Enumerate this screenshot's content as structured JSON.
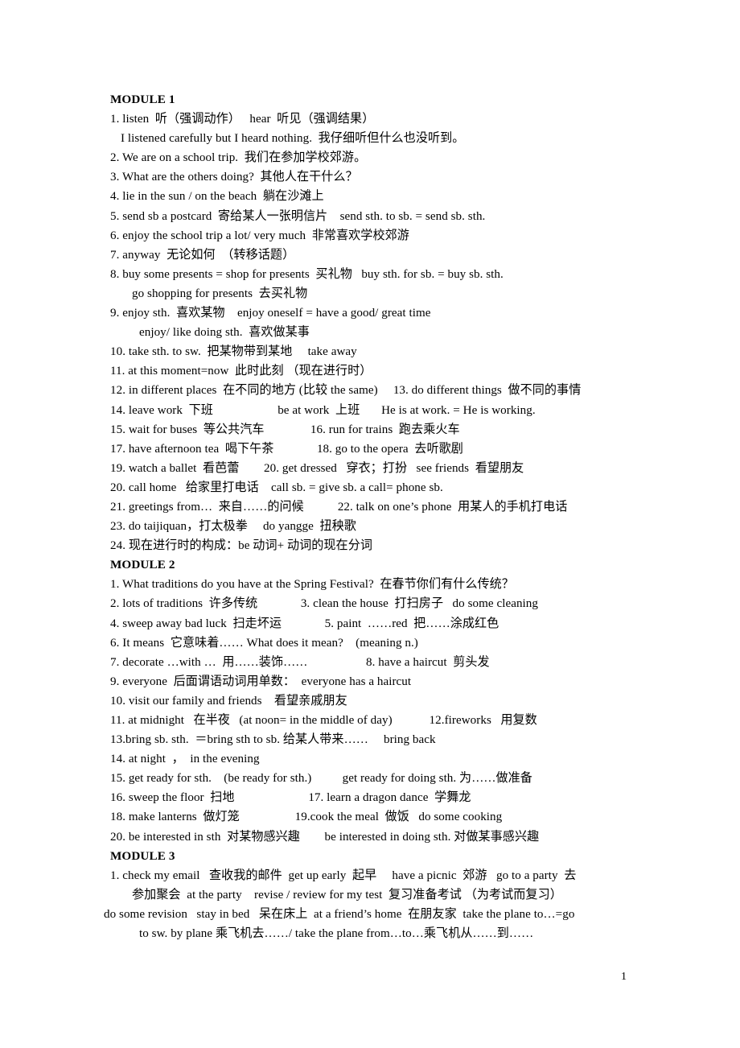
{
  "document": {
    "page_number": "1",
    "sections": [
      {
        "heading": "MODULE 1",
        "lines": [
          {
            "indent": 0,
            "text": "1. listen  听（强调动作）   hear  听见（强调结果）"
          },
          {
            "indent": 1,
            "text": "I listened carefully but I heard nothing.  我仔细听但什么也没听到。"
          },
          {
            "indent": 0,
            "text": "2. We are on a school trip.  我们在参加学校郊游。"
          },
          {
            "indent": 0,
            "text": "3. What are the others doing?  其他人在干什么？"
          },
          {
            "indent": 0,
            "text": "4. lie in the sun / on the beach  躺在沙滩上"
          },
          {
            "indent": 0,
            "text": "5. send sb a postcard  寄给某人一张明信片    send sth. to sb. = send sb. sth."
          },
          {
            "indent": 0,
            "text": "6. enjoy the school trip a lot/ very much  非常喜欢学校郊游"
          },
          {
            "indent": 0,
            "text": "7. anyway  无论如何  （转移话题）"
          },
          {
            "indent": 0,
            "text": "8. buy some presents = shop for presents  买礼物   buy sth. for sb. = buy sb. sth."
          },
          {
            "indent": 2,
            "text": "go shopping for presents  去买礼物"
          },
          {
            "indent": 0,
            "text": "9. enjoy sth.  喜欢某物    enjoy oneself = have a good/ great time"
          },
          {
            "indent": 3,
            "text": "enjoy/ like doing sth.  喜欢做某事"
          },
          {
            "indent": 0,
            "text": "10. take sth. to sw.  把某物带到某地     take away"
          },
          {
            "indent": 0,
            "text": "11. at this moment=now  此时此刻 （现在进行时）"
          },
          {
            "indent": 0,
            "text": "12. in different places  在不同的地方 (比较 the same)     13. do different things  做不同的事情"
          },
          {
            "indent": 0,
            "text": "14. leave work  下班                     be at work  上班       He is at work. = He is working."
          },
          {
            "indent": 0,
            "text": "15. wait for buses  等公共汽车               16. run for trains  跑去乘火车"
          },
          {
            "indent": 0,
            "text": "17. have afternoon tea  喝下午茶              18. go to the opera  去听歌剧"
          },
          {
            "indent": 0,
            "text": "19. watch a ballet  看芭蕾        20. get dressed   穿衣；打扮   see friends  看望朋友"
          },
          {
            "indent": 0,
            "text": "20. call home   给家里打电话    call sb. = give sb. a call= phone sb."
          },
          {
            "indent": 0,
            "text": "21. greetings from…  来自……的问候           22. talk on one’s phone  用某人的手机打电话"
          },
          {
            "indent": 0,
            "text": "23. do taijiquan，打太极拳     do yangge  扭秧歌"
          },
          {
            "indent": 0,
            "text": "24. 现在进行时的构成：be 动词+ 动词的现在分词"
          }
        ]
      },
      {
        "heading": "MODULE 2",
        "lines": [
          {
            "indent": 0,
            "text": "1. What traditions do you have at the Spring Festival?  在春节你们有什么传统？"
          },
          {
            "indent": 0,
            "text": "2. lots of traditions  许多传统              3. clean the house  打扫房子   do some cleaning"
          },
          {
            "indent": 0,
            "text": "4. sweep away bad luck  扫走坏运              5. paint  ……red  把……涂成红色"
          },
          {
            "indent": 0,
            "text": "6. It means  它意味着…… What does it mean?    (meaning n.)"
          },
          {
            "indent": 0,
            "text": "7. decorate …with …  用……装饰……                   8. have a haircut  剪头发"
          },
          {
            "indent": 0,
            "text": "9. everyone  后面谓语动词用单数：  everyone has a haircut"
          },
          {
            "indent": 0,
            "text": "10. visit our family and friends    看望亲戚朋友"
          },
          {
            "indent": 0,
            "text": "11. at midnight   在半夜   (at noon= in the middle of day)            12.fireworks   用复数"
          },
          {
            "indent": 0,
            "text": "13.bring sb. sth.  ＝bring sth to sb. 给某人带来……     bring back"
          },
          {
            "indent": 0,
            "text": "14. at night  ，  in the evening"
          },
          {
            "indent": 0,
            "text": "15. get ready for sth.    (be ready for sth.)          get ready for doing sth. 为……做准备"
          },
          {
            "indent": 0,
            "text": "16. sweep the floor  扫地                        17. learn a dragon dance  学舞龙"
          },
          {
            "indent": 0,
            "text": "18. make lanterns  做灯笼                  19.cook the meal  做饭   do some cooking"
          },
          {
            "indent": 0,
            "text": "20. be interested in sth  对某物感兴趣        be interested in doing sth. 对做某事感兴趣"
          }
        ]
      },
      {
        "heading": "MODULE 3",
        "lines": [
          {
            "indent": 0,
            "text": "1. check my email   查收我的邮件  get up early  起早     have a picnic  郊游   go to a party  去"
          },
          {
            "indent": 2,
            "text": "参加聚会  at the party    revise / review for my test  复习准备考试 （为考试而复习）"
          },
          {
            "indent": -1,
            "text": "do some revision   stay in bed   呆在床上  at a friend’s home  在朋友家  take the plane to…=go"
          },
          {
            "indent": 3,
            "text": "to sw. by plane 乘飞机去……/ take the plane from…to…乘飞机从……到……"
          }
        ]
      }
    ]
  }
}
